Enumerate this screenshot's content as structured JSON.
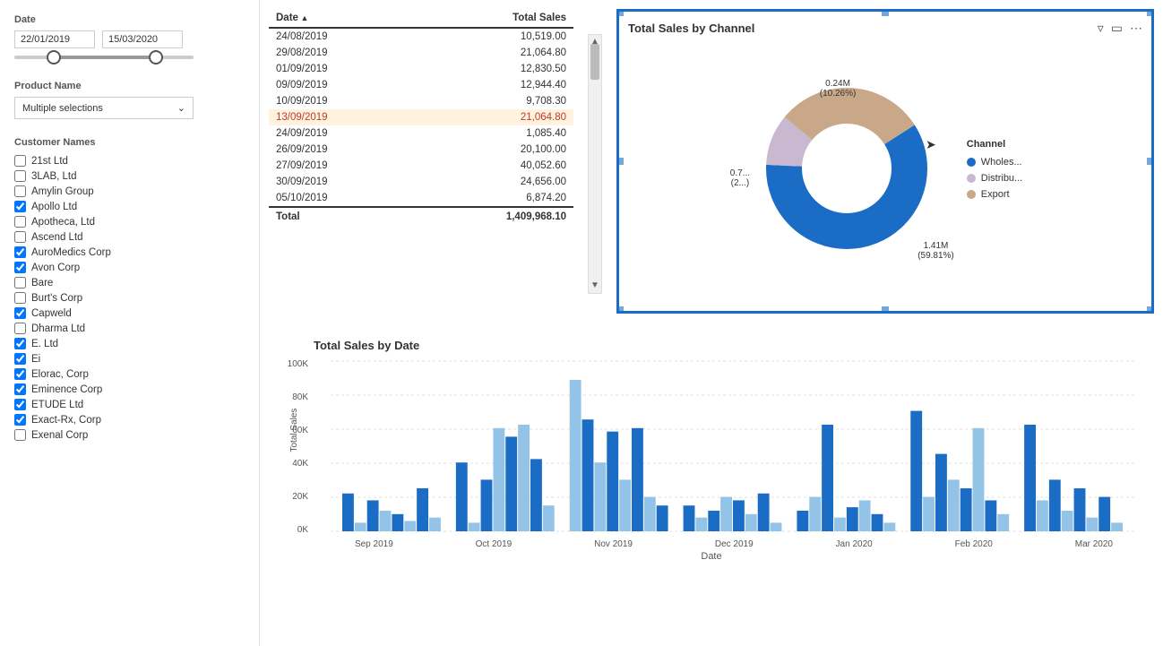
{
  "sidebar": {
    "date_label": "Date",
    "date_start": "22/01/2019",
    "date_end": "15/03/2020",
    "product_label": "Product Name",
    "product_value": "Multiple selections",
    "customer_label": "Customer Names",
    "customers": [
      {
        "name": "21st Ltd",
        "checked": false
      },
      {
        "name": "3LAB, Ltd",
        "checked": false
      },
      {
        "name": "Amylin Group",
        "checked": false
      },
      {
        "name": "Apollo Ltd",
        "checked": true
      },
      {
        "name": "Apotheca, Ltd",
        "checked": false
      },
      {
        "name": "Ascend Ltd",
        "checked": false
      },
      {
        "name": "AuroMedics Corp",
        "checked": true
      },
      {
        "name": "Avon Corp",
        "checked": true
      },
      {
        "name": "Bare",
        "checked": false
      },
      {
        "name": "Burt's Corp",
        "checked": false
      },
      {
        "name": "Capweld",
        "checked": true
      },
      {
        "name": "Dharma Ltd",
        "checked": false
      },
      {
        "name": "E. Ltd",
        "checked": true
      },
      {
        "name": "Ei",
        "checked": true
      },
      {
        "name": "Elorac, Corp",
        "checked": true
      },
      {
        "name": "Eminence Corp",
        "checked": true
      },
      {
        "name": "ETUDE Ltd",
        "checked": true
      },
      {
        "name": "Exact-Rx, Corp",
        "checked": true
      },
      {
        "name": "Exenal Corp",
        "checked": false
      }
    ]
  },
  "table": {
    "col1": "Date",
    "col2": "Total Sales",
    "rows": [
      {
        "date": "24/08/2019",
        "sales": "10,519.00",
        "highlight": false
      },
      {
        "date": "29/08/2019",
        "sales": "21,064.80",
        "highlight": false
      },
      {
        "date": "01/09/2019",
        "sales": "12,830.50",
        "highlight": false
      },
      {
        "date": "09/09/2019",
        "sales": "12,944.40",
        "highlight": false
      },
      {
        "date": "10/09/2019",
        "sales": "9,708.30",
        "highlight": false
      },
      {
        "date": "13/09/2019",
        "sales": "21,064.80",
        "highlight": true
      },
      {
        "date": "24/09/2019",
        "sales": "1,085.40",
        "highlight": false
      },
      {
        "date": "26/09/2019",
        "sales": "20,100.00",
        "highlight": false
      },
      {
        "date": "27/09/2019",
        "sales": "40,052.60",
        "highlight": false
      },
      {
        "date": "30/09/2019",
        "sales": "24,656.00",
        "highlight": false
      },
      {
        "date": "05/10/2019",
        "sales": "6,874.20",
        "highlight": false
      }
    ],
    "total_label": "Total",
    "total_value": "1,409,968.10"
  },
  "donut_chart": {
    "title": "Total Sales by Channel",
    "legend_title": "Channel",
    "segments": [
      {
        "label": "Wholes...",
        "value": "1.41M",
        "pct": "59.81%",
        "color": "#1a6cc4"
      },
      {
        "label": "Distribu...",
        "value": "0.24M",
        "pct": "10.26%",
        "color": "#c8b8d0"
      },
      {
        "label": "Export",
        "value": "0.7...",
        "pct": "2...",
        "color": "#d4c4b0"
      }
    ],
    "annotation_top": "0.24M",
    "annotation_top_pct": "(10.26%)",
    "annotation_bottom": "1.41M",
    "annotation_bottom_pct": "(59.81%)",
    "annotation_left": "0.7...",
    "annotation_left_pct": "(2...)"
  },
  "bar_chart": {
    "title": "Total Sales by Date",
    "y_label": "Total Sales",
    "x_label": "Date",
    "y_ticks": [
      "100K",
      "80K",
      "60K",
      "40K",
      "20K",
      "0K"
    ],
    "x_labels": [
      "Sep 2019",
      "Oct 2019",
      "Nov 2019",
      "Dec 2019",
      "Jan 2020",
      "Feb 2020",
      "Mar 2020"
    ]
  }
}
